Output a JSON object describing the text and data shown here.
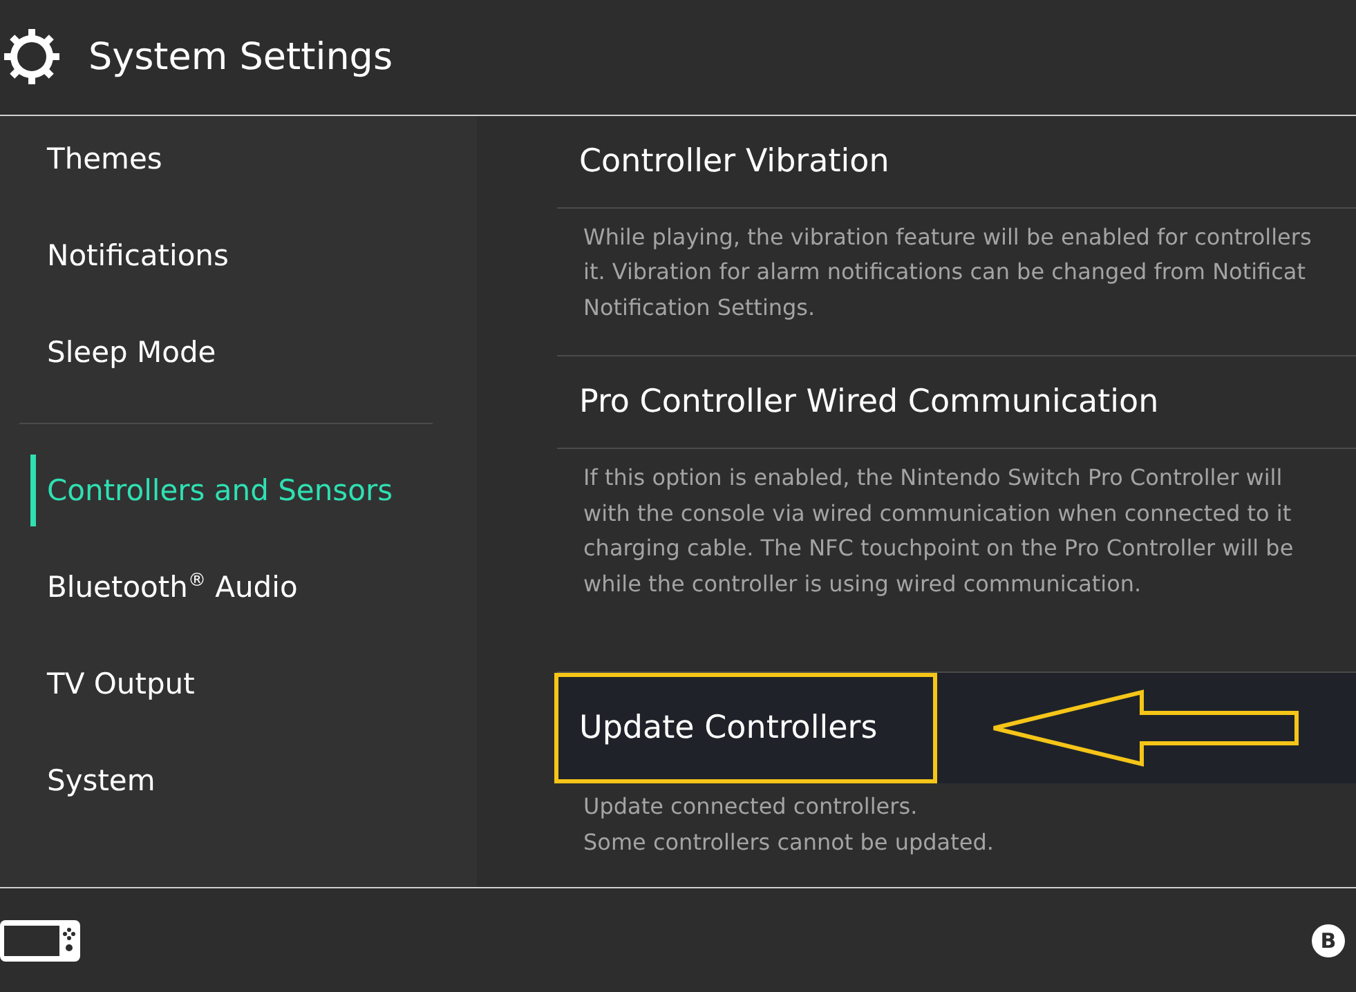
{
  "header": {
    "title": "System Settings"
  },
  "sidebar": {
    "groups": [
      {
        "items": [
          {
            "label": "Themes",
            "selected": false
          },
          {
            "label": "Notifications",
            "selected": false
          },
          {
            "label": "Sleep Mode",
            "selected": false
          }
        ]
      },
      {
        "items": [
          {
            "label": "Controllers and Sensors",
            "selected": true
          },
          {
            "label": "Bluetooth$^{®}$ Audio",
            "selected": false
          },
          {
            "label": "TV Output",
            "selected": false
          },
          {
            "label": "System",
            "selected": false
          }
        ]
      }
    ]
  },
  "sections": [
    {
      "title": "Controller Vibration",
      "selected": false,
      "annotated": false,
      "description": [
        "While playing, the vibration feature will be enabled for controllers",
        "it. Vibration for alarm notifications can be changed from Notificat",
        "Notification Settings."
      ]
    },
    {
      "title": "Pro Controller Wired Communication",
      "selected": false,
      "annotated": false,
      "description": [
        "If this option is enabled, the Nintendo Switch Pro Controller will",
        "with the console via wired communication when connected to it",
        "charging cable. The NFC touchpoint on the Pro Controller will be",
        "while the controller is using wired communication."
      ]
    },
    {
      "title": "Update Controllers",
      "selected": true,
      "annotated": true,
      "description": [
        "Update connected controllers.",
        "Some controllers cannot be updated."
      ]
    }
  ],
  "footer": {
    "button_hint": "B"
  }
}
